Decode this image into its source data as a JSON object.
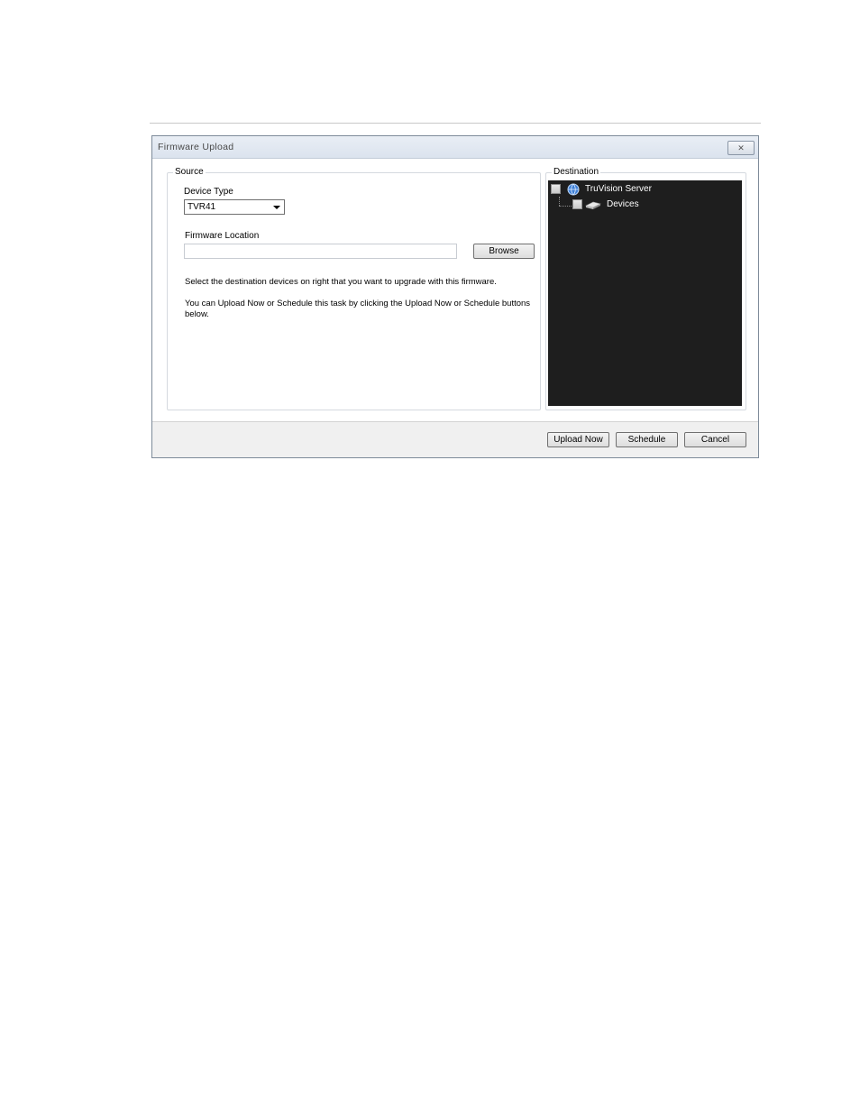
{
  "window": {
    "title": "Firmware Upload",
    "close_glyph": "✕"
  },
  "source": {
    "legend": "Source",
    "device_type_label": "Device Type",
    "device_type_value": "TVR41",
    "firmware_location_label": "Firmware Location",
    "firmware_location_value": "",
    "browse_label": "Browse",
    "info_text_1": "Select the destination devices on right that you want to upgrade with this firmware.",
    "info_text_2": "You can Upload Now or Schedule this task by clicking the Upload Now or Schedule buttons below."
  },
  "destination": {
    "legend": "Destination",
    "tree": [
      {
        "label": "TruVision Server",
        "icon": "globe-icon",
        "checked": false
      },
      {
        "label": "Devices",
        "icon": "device-icon",
        "checked": false
      }
    ]
  },
  "buttons": {
    "upload_now": "Upload Now",
    "schedule": "Schedule",
    "cancel": "Cancel"
  }
}
